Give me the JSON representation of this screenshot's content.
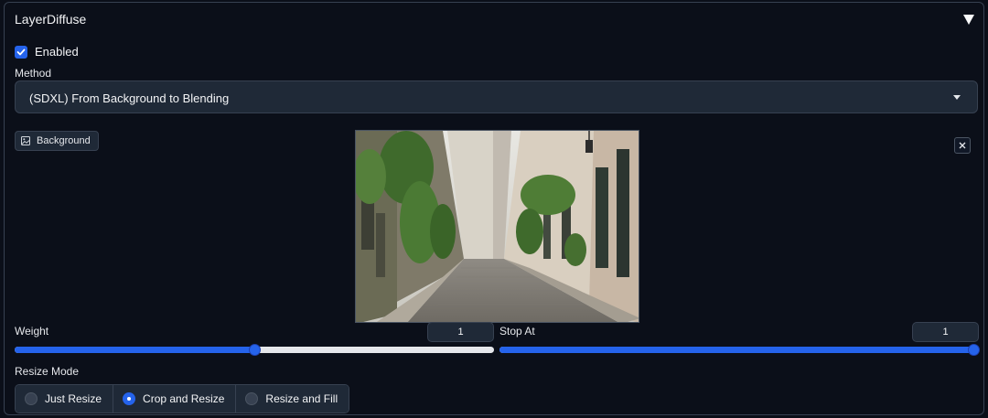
{
  "header": {
    "title": "LayerDiffuse",
    "collapse_icon": "triangle-down-icon"
  },
  "enabled": {
    "label": "Enabled",
    "checked": true
  },
  "method": {
    "label": "Method",
    "value": "(SDXL) From Background to Blending"
  },
  "background": {
    "label": "Background",
    "icon": "image-icon",
    "clear_icon": "close-icon"
  },
  "weight": {
    "label": "Weight",
    "value": "1",
    "level_fraction": 0.5
  },
  "stop_at": {
    "label": "Stop At",
    "value": "1",
    "level_fraction": 1.0
  },
  "resize_mode": {
    "label": "Resize Mode",
    "options": [
      {
        "label": "Just Resize",
        "selected": false
      },
      {
        "label": "Crop and Resize",
        "selected": true
      },
      {
        "label": "Resize and Fill",
        "selected": false
      }
    ]
  },
  "colors": {
    "accent": "#2563eb",
    "background": "#0b0f19",
    "surface": "#1f2937",
    "border": "#374151"
  }
}
